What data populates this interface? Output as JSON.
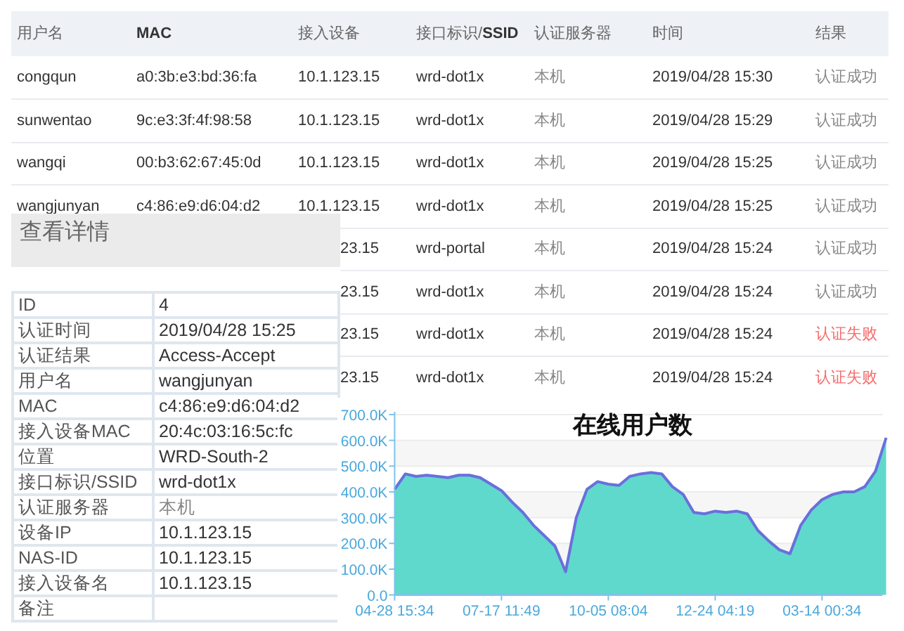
{
  "table": {
    "columns": [
      {
        "label": "用户名"
      },
      {
        "label": "MAC",
        "bold": true
      },
      {
        "label": "接入设备"
      },
      {
        "label": "接口标识/**SSID**"
      },
      {
        "label": "认证服务器"
      },
      {
        "label": "时间"
      },
      {
        "label": "结果"
      }
    ],
    "rows": [
      {
        "username": "congqun",
        "mac": "a0:3b:e3:bd:36:fa",
        "device": "10.1.123.15",
        "ssid": "wrd-dot1x",
        "server": "本机",
        "time": "2019/04/28 15:30",
        "result": "认证成功",
        "failed": false
      },
      {
        "username": "sunwentao",
        "mac": "9c:e3:3f:4f:98:58",
        "device": "10.1.123.15",
        "ssid": "wrd-dot1x",
        "server": "本机",
        "time": "2019/04/28 15:29",
        "result": "认证成功",
        "failed": false
      },
      {
        "username": "wangqi",
        "mac": "00:b3:62:67:45:0d",
        "device": "10.1.123.15",
        "ssid": "wrd-dot1x",
        "server": "本机",
        "time": "2019/04/28 15:25",
        "result": "认证成功",
        "failed": false
      },
      {
        "username": "wangjunyan",
        "mac": "c4:86:e9:d6:04:d2",
        "device": "10.1.123.15",
        "ssid": "wrd-dot1x",
        "server": "本机",
        "time": "2019/04/28 15:25",
        "result": "认证成功",
        "failed": false
      },
      {
        "device": "23.15",
        "ssid": "wrd-portal",
        "server": "本机",
        "time": "2019/04/28 15:24",
        "result": "认证成功",
        "failed": false
      },
      {
        "device": "23.15",
        "ssid": "wrd-dot1x",
        "server": "本机",
        "time": "2019/04/28 15:24",
        "result": "认证成功",
        "failed": false
      },
      {
        "device": "23.15",
        "ssid": "wrd-dot1x",
        "server": "本机",
        "time": "2019/04/28 15:24",
        "result": "认证失败",
        "failed": true
      },
      {
        "device": "23.15",
        "ssid": "wrd-dot1x",
        "server": "本机",
        "time": "2019/04/28 15:24",
        "result": "认证失败",
        "failed": true
      }
    ]
  },
  "details": {
    "title": "查看详情",
    "fields": [
      {
        "label": "ID",
        "value": "4"
      },
      {
        "label": "认证时间",
        "value": "2019/04/28 15:25"
      },
      {
        "label": "认证结果",
        "value": "Access-Accept"
      },
      {
        "label": "用户名",
        "value": "wangjunyan"
      },
      {
        "label": "MAC",
        "value": "c4:86:e9:d6:04:d2"
      },
      {
        "label": "接入设备MAC",
        "value": "20:4c:03:16:5c:fc"
      },
      {
        "label": "位置",
        "value": "WRD-South-2"
      },
      {
        "label": "接口标识/SSID",
        "value": "wrd-dot1x"
      },
      {
        "label": "认证服务器",
        "value": "本机",
        "muted": true
      },
      {
        "label": "设备IP",
        "value": "10.1.123.15"
      },
      {
        "label": "NAS-ID",
        "value": "10.1.123.15"
      },
      {
        "label": "接入设备名",
        "value": "10.1.123.15"
      },
      {
        "label": "备注"
      }
    ]
  },
  "chart": {
    "chart_data": {
      "type": "area",
      "title": "在线用户数",
      "categories": [
        "04-28 15:34",
        null,
        null,
        null,
        null,
        null,
        null,
        null,
        null,
        null,
        "07-17 11:49",
        null,
        null,
        null,
        null,
        null,
        null,
        null,
        null,
        null,
        "10-05 08:04",
        null,
        null,
        null,
        null,
        null,
        null,
        null,
        null,
        null,
        "12-24 04:19",
        null,
        null,
        null,
        null,
        null,
        null,
        null,
        null,
        null,
        "03-14 00:34",
        null,
        null,
        null,
        null,
        null,
        null
      ],
      "series": [
        {
          "color": "#6a6fdc",
          "values": [
            410,
            470,
            460,
            465,
            460,
            455,
            465,
            465,
            455,
            430,
            405,
            360,
            320,
            270,
            230,
            190,
            90,
            300,
            410,
            440,
            430,
            425,
            460,
            470,
            475,
            470,
            420,
            390,
            320,
            315,
            325,
            320,
            325,
            315,
            250,
            210,
            175,
            160,
            270,
            330,
            370,
            390,
            400,
            400,
            420,
            480,
            610
          ]
        }
      ],
      "ylim": [
        0,
        700
      ],
      "grid": true,
      "yticks": [
        {
          "value": 0,
          "label": "0.0"
        },
        {
          "value": 100,
          "label": "100.0K"
        },
        {
          "value": 200,
          "label": "200.0K"
        },
        {
          "value": 300,
          "label": "300.0K"
        },
        {
          "value": 400,
          "label": "400.0K"
        },
        {
          "value": 500,
          "label": "500.0K"
        },
        {
          "value": 600,
          "label": "600.0K"
        },
        {
          "value": 700,
          "label": "700.0K"
        }
      ]
    }
  }
}
